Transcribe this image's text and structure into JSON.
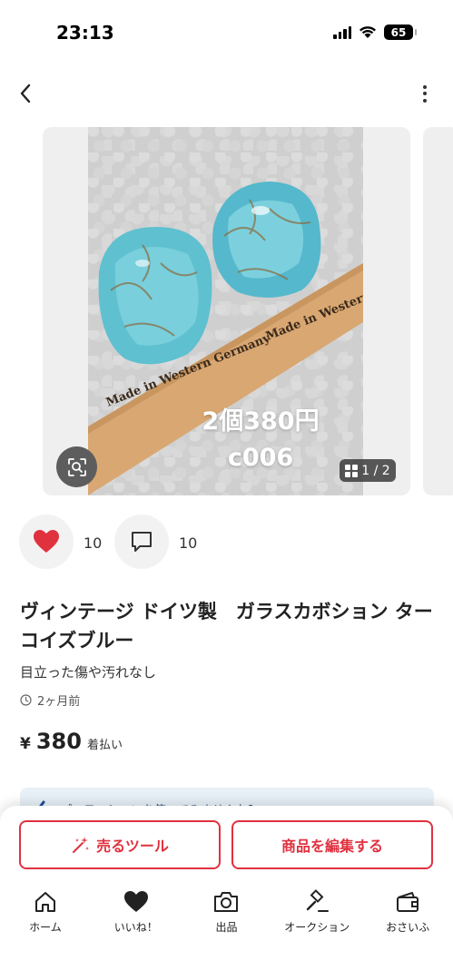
{
  "status_bar": {
    "time": "23:13",
    "battery": "65"
  },
  "nav": {
    "back_icon": "chevron-left-icon",
    "more_icon": "more-vertical-icon"
  },
  "carousel": {
    "caption_line1": "2個380円",
    "caption_line2": "c006",
    "photo_label_text_1": "Made in Western Germany",
    "photo_label_text_2": "Made in Western Germany",
    "counter": "1 / 2"
  },
  "reactions": {
    "likes": "10",
    "comments": "10",
    "like_color": "#e0313f"
  },
  "item": {
    "title": "ヴィンテージ ドイツ製　ガラスカボション ターコイズブルー",
    "condition": "目立った傷や汚れなし",
    "posted": "2ヶ月前",
    "price_yen": "¥",
    "price": "380",
    "price_note": "着払い"
  },
  "promo": {
    "text": "プロモーションを使ってみませんか？"
  },
  "actions": {
    "sell_tool": "売るツール",
    "edit_item": "商品を編集する",
    "accent_color": "#e0313f"
  },
  "tabbar": {
    "items": [
      {
        "label": "ホーム",
        "icon": "home-icon"
      },
      {
        "label": "いいね！",
        "icon": "heart-icon"
      },
      {
        "label": "出品",
        "icon": "camera-icon"
      },
      {
        "label": "オークション",
        "icon": "gavel-icon"
      },
      {
        "label": "おさいふ",
        "icon": "wallet-icon"
      }
    ]
  }
}
